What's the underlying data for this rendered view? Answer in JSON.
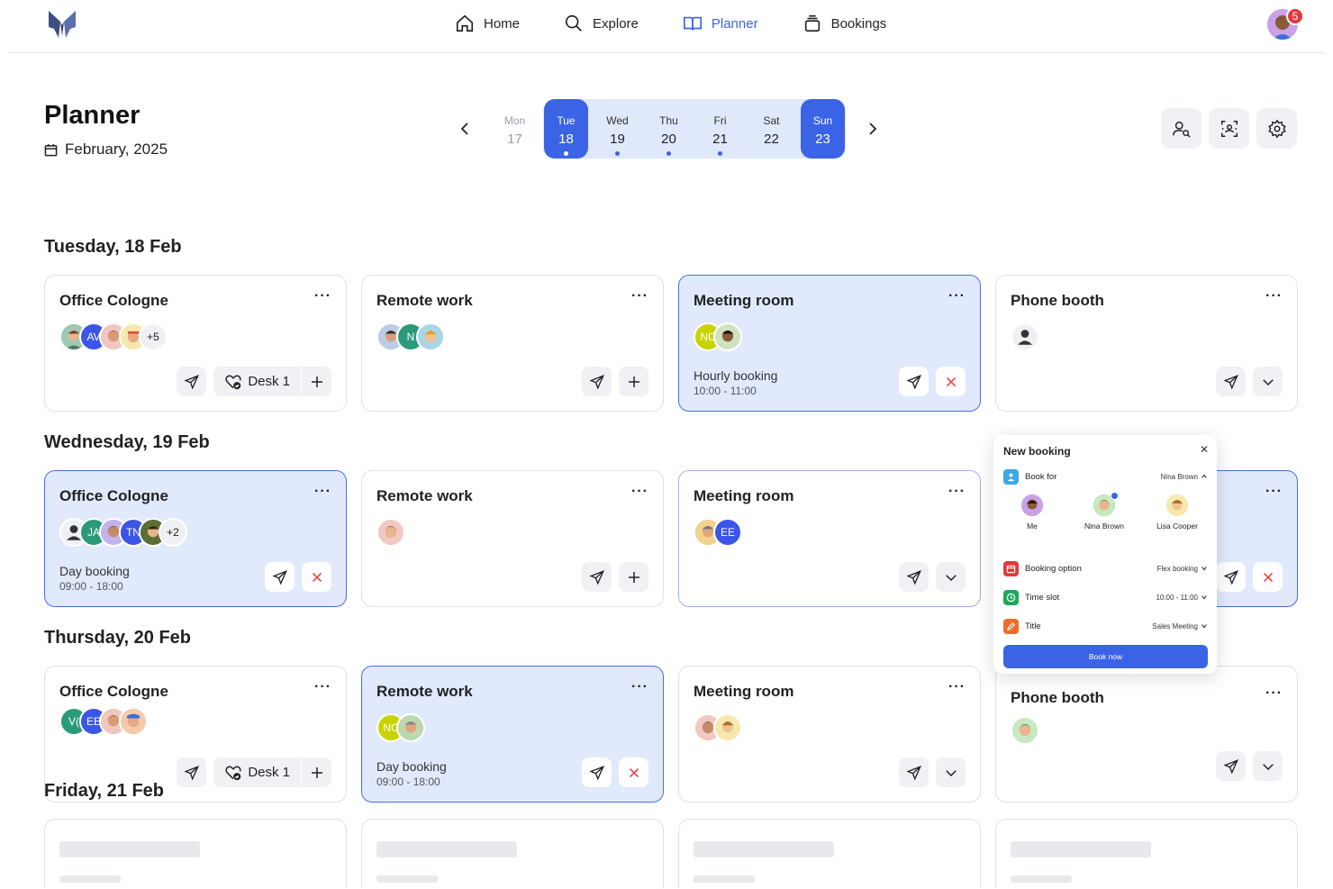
{
  "nav": {
    "items": [
      {
        "label": "Home",
        "icon": "home-icon"
      },
      {
        "label": "Explore",
        "icon": "search-icon"
      },
      {
        "label": "Planner",
        "icon": "book-icon"
      },
      {
        "label": "Bookings",
        "icon": "stack-icon"
      }
    ],
    "notifications": "5"
  },
  "header": {
    "title": "Planner",
    "month": "February, 2025"
  },
  "week": [
    {
      "name": "Mon",
      "num": "17"
    },
    {
      "name": "Tue",
      "num": "18"
    },
    {
      "name": "Wed",
      "num": "19"
    },
    {
      "name": "Thu",
      "num": "20"
    },
    {
      "name": "Fri",
      "num": "21"
    },
    {
      "name": "Sat",
      "num": "22"
    },
    {
      "name": "Sun",
      "num": "23"
    }
  ],
  "sections": [
    {
      "heading": "Tuesday, 18 Feb"
    },
    {
      "heading": "Wednesday, 19 Feb"
    },
    {
      "heading": "Thursday, 20 Feb"
    },
    {
      "heading": "Friday, 21 Feb"
    }
  ],
  "cards": {
    "tue_office": {
      "title": "Office Cologne",
      "initials": "AV",
      "more": "+5",
      "desk": "Desk 1"
    },
    "tue_remote": {
      "title": "Remote work",
      "initials": "N"
    },
    "tue_meeting": {
      "title": "Meeting room",
      "initials": "NC",
      "btype": "Hourly booking",
      "btime": "10:00 - 11:00"
    },
    "tue_phone": {
      "title": "Phone booth"
    },
    "wed_office": {
      "title": "Office Cologne",
      "initials1": "JA",
      "initials2": "TN",
      "more": "+2",
      "btype": "Day booking",
      "btime": "09:00 - 18:00"
    },
    "wed_remote": {
      "title": "Remote work"
    },
    "wed_meeting": {
      "title": "Meeting room",
      "initials": "EE"
    },
    "thu_office": {
      "title": "Office Cologne",
      "initials1": "V(",
      "initials2": "EE",
      "desk": "Desk 1"
    },
    "thu_remote": {
      "title": "Remote work",
      "initials": "NC",
      "btype": "Day booking",
      "btime": "09:00 - 18:00"
    },
    "thu_meeting": {
      "title": "Meeting room"
    },
    "thu_phone": {
      "title": "Phone booth"
    }
  },
  "popup": {
    "title": "New booking",
    "book_for_label": "Book for",
    "book_for_value": "Nina Brown",
    "people": [
      {
        "name": "Me"
      },
      {
        "name": "Nina Brown"
      },
      {
        "name": "Lisa Cooper"
      }
    ],
    "booking_option_label": "Booking option",
    "booking_option_value": "Flex booking",
    "time_slot_label": "Time slot",
    "time_slot_value": "10:00 - 11:00",
    "title_label": "Title",
    "title_value": "Sales Meeting",
    "book_now": "Book now"
  },
  "colors": {
    "accent": "#3b63e6",
    "booked_bg": "#e1e9fc",
    "danger": "#e5383b"
  }
}
